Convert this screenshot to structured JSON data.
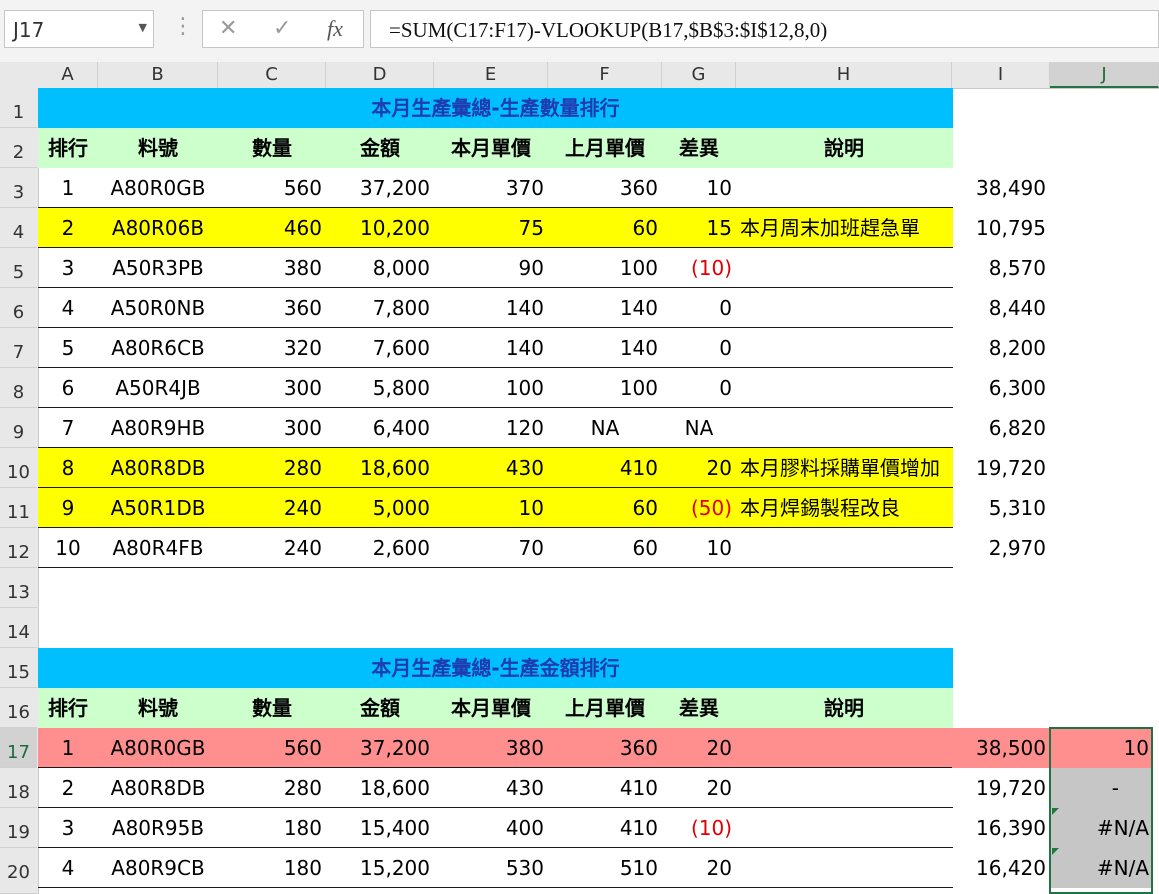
{
  "name_box": "J17",
  "formula": "=SUM(C17:F17)-VLOOKUP(B17,$B$3:$I$12,8,0)",
  "icons": {
    "cancel": "close-icon",
    "enter": "check-icon",
    "fx": "function-icon",
    "dropdown": "chevron-down-icon"
  },
  "fx_label": "fx",
  "columns": [
    "A",
    "B",
    "C",
    "D",
    "E",
    "F",
    "G",
    "H",
    "I",
    "J"
  ],
  "rows": [
    "1",
    "2",
    "3",
    "4",
    "5",
    "6",
    "7",
    "8",
    "9",
    "10",
    "11",
    "12",
    "13",
    "14",
    "15",
    "16",
    "17",
    "18",
    "19",
    "20"
  ],
  "selected_cell": {
    "column": "J",
    "row": "17"
  },
  "colors": {
    "title": "#00bfff",
    "header": "#ccffcc",
    "highlight": "#ffff00",
    "top_row": "#ff8f8f",
    "selection": "#217346"
  },
  "table1": {
    "title": "本月生產彙總-生產數量排行",
    "headers": [
      "排行",
      "料號",
      "數量",
      "金額",
      "本月單價",
      "上月單價",
      "差異",
      "說明"
    ],
    "rows": [
      {
        "rank": "1",
        "part": "A80R0GB",
        "qty": "560",
        "amount": "37,200",
        "cur": "370",
        "prev": "360",
        "diff": "10",
        "note": "",
        "i": "38,490"
      },
      {
        "rank": "2",
        "part": "A80R06B",
        "qty": "460",
        "amount": "10,200",
        "cur": "75",
        "prev": "60",
        "diff": "15",
        "note": "本月周末加班趕急單",
        "i": "10,795"
      },
      {
        "rank": "3",
        "part": "A50R3PB",
        "qty": "380",
        "amount": "8,000",
        "cur": "90",
        "prev": "100",
        "diff": "(10)",
        "note": "",
        "i": "8,570"
      },
      {
        "rank": "4",
        "part": "A50R0NB",
        "qty": "360",
        "amount": "7,800",
        "cur": "140",
        "prev": "140",
        "diff": "0",
        "note": "",
        "i": "8,440"
      },
      {
        "rank": "5",
        "part": "A80R6CB",
        "qty": "320",
        "amount": "7,600",
        "cur": "140",
        "prev": "140",
        "diff": "0",
        "note": "",
        "i": "8,200"
      },
      {
        "rank": "6",
        "part": "A50R4JB",
        "qty": "300",
        "amount": "5,800",
        "cur": "100",
        "prev": "100",
        "diff": "0",
        "note": "",
        "i": "6,300"
      },
      {
        "rank": "7",
        "part": "A80R9HB",
        "qty": "300",
        "amount": "6,400",
        "cur": "120",
        "prev": "NA",
        "diff": "NA",
        "note": "",
        "i": "6,820"
      },
      {
        "rank": "8",
        "part": "A80R8DB",
        "qty": "280",
        "amount": "18,600",
        "cur": "430",
        "prev": "410",
        "diff": "20",
        "note": "本月膠料採購單價增加",
        "i": "19,720"
      },
      {
        "rank": "9",
        "part": "A50R1DB",
        "qty": "240",
        "amount": "5,000",
        "cur": "10",
        "prev": "60",
        "diff": "(50)",
        "note": "本月焊錫製程改良",
        "i": "5,310"
      },
      {
        "rank": "10",
        "part": "A80R4FB",
        "qty": "240",
        "amount": "2,600",
        "cur": "70",
        "prev": "60",
        "diff": "10",
        "note": "",
        "i": "2,970"
      }
    ]
  },
  "table2": {
    "title": "本月生產彙總-生產金額排行",
    "headers": [
      "排行",
      "料號",
      "數量",
      "金額",
      "本月單價",
      "上月單價",
      "差異",
      "說明"
    ],
    "rows": [
      {
        "rank": "1",
        "part": "A80R0GB",
        "qty": "560",
        "amount": "37,200",
        "cur": "380",
        "prev": "360",
        "diff": "20",
        "note": "",
        "i": "38,500",
        "j": "10"
      },
      {
        "rank": "2",
        "part": "A80R8DB",
        "qty": "280",
        "amount": "18,600",
        "cur": "430",
        "prev": "410",
        "diff": "20",
        "note": "",
        "i": "19,720",
        "j": "-"
      },
      {
        "rank": "3",
        "part": "A80R95B",
        "qty": "180",
        "amount": "15,400",
        "cur": "400",
        "prev": "410",
        "diff": "(10)",
        "note": "",
        "i": "16,390",
        "j": "#N/A"
      },
      {
        "rank": "4",
        "part": "A80R9CB",
        "qty": "180",
        "amount": "15,200",
        "cur": "530",
        "prev": "510",
        "diff": "20",
        "note": "",
        "i": "16,420",
        "j": "#N/A"
      }
    ]
  }
}
